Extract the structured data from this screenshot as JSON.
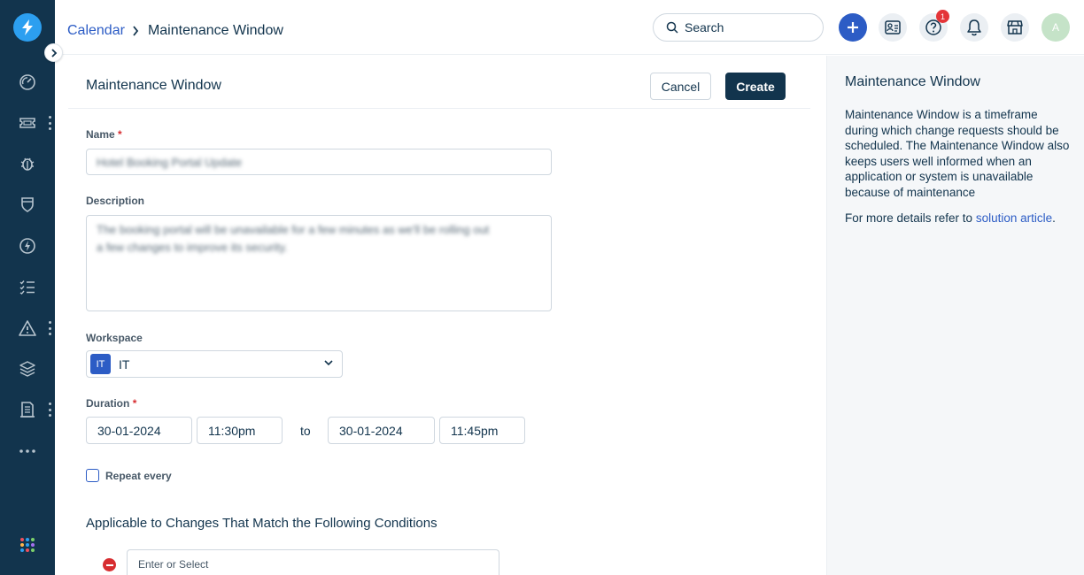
{
  "breadcrumb": {
    "parent": "Calendar",
    "current": "Maintenance Window"
  },
  "header": {
    "search_label": "Search",
    "help_badge": "1",
    "avatar_initial": "A"
  },
  "form": {
    "title": "Maintenance Window",
    "cancel_label": "Cancel",
    "create_label": "Create",
    "name_label": "Name",
    "name_value": "Hotel Booking Portal Update",
    "description_label": "Description",
    "description_line1": "The booking portal will be unavailable for a few minutes as we'll be rolling out",
    "description_line2": "a few changes to improve its security.",
    "workspace_label": "Workspace",
    "workspace_chip": "IT",
    "workspace_value": "IT",
    "duration_label": "Duration",
    "start_date": "30-01-2024",
    "start_time": "11:30pm",
    "to_label": "to",
    "end_date": "30-01-2024",
    "end_time": "11:45pm",
    "repeat_label": "Repeat every",
    "repeat_checked": false,
    "conditions_title": "Applicable to Changes That Match the Following Conditions",
    "condition_placeholder": "Enter or Select",
    "required_mark": "*"
  },
  "side_panel": {
    "title": "Maintenance Window",
    "body": "Maintenance Window is a timeframe during which change requests should be scheduled. The Maintenance Window also keeps users well informed when an application or system is unavailable because of maintenance",
    "more_prefix": "For more details refer to ",
    "link_text": "solution article",
    "more_suffix": "."
  },
  "colors": {
    "sidebar": "#12344d",
    "accent": "#2c5cc5",
    "logo": "#2c9ff0",
    "danger": "#d72d30"
  },
  "icons": [
    "lightning-logo-icon",
    "dashboard-icon",
    "ticket-icon",
    "bug-icon",
    "shield-icon",
    "bolt-icon",
    "tasks-icon",
    "warning-icon",
    "layers-icon",
    "document-icon",
    "more-icon",
    "apps-grid-icon"
  ]
}
